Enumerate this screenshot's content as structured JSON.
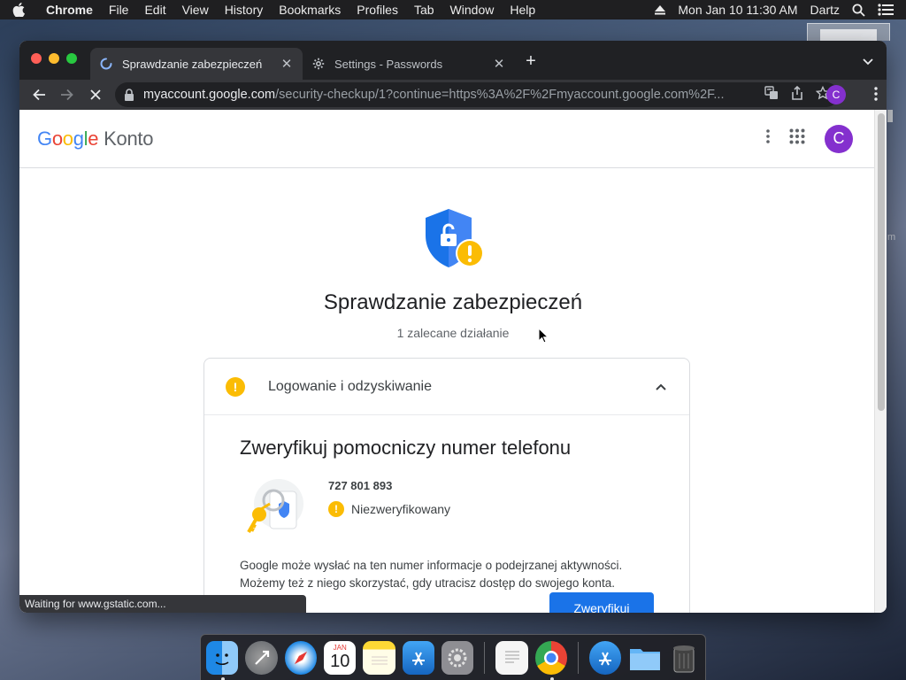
{
  "menubar": {
    "items": [
      "Chrome",
      "File",
      "Edit",
      "View",
      "History",
      "Bookmarks",
      "Profiles",
      "Tab",
      "Window",
      "Help"
    ],
    "clock": "Mon Jan 10  11:30 AM",
    "user": "Dartz"
  },
  "tabs": [
    {
      "title": "Sprawdzanie zabezpieczeń",
      "active": true
    },
    {
      "title": "Settings - Passwords",
      "active": false
    }
  ],
  "omnibox": {
    "host": "myaccount.google.com",
    "path": "/security-checkup/1?continue=https%3A%2F%2Fmyaccount.google.com%2F..."
  },
  "profile_initial": "C",
  "header": {
    "logo": {
      "G": "G",
      "o1": "o",
      "o2": "o",
      "g": "g",
      "l": "l",
      "e": "e"
    },
    "product": "Konto",
    "avatar_initial": "C"
  },
  "hero": {
    "title": "Sprawdzanie zabezpieczeń",
    "subtitle": "1 zalecane działanie"
  },
  "card": {
    "section_label": "Logowanie i odzyskiwanie",
    "heading": "Zweryfikuj pomocniczy numer telefonu",
    "phone_number": "727 801 893",
    "phone_status": "Niezweryfikowany",
    "description_line1": "Google może wysłać na ten numer informacje o podejrzanej aktywności.",
    "description_line2": "Możemy też z niego skorzystać, gdy utracisz dostęp do swojego konta.",
    "verify_button": "Zweryfikuj"
  },
  "status_bar": "Waiting for www.gstatic.com...",
  "dock": {
    "calendar_month": "JAN",
    "calendar_day": "10"
  },
  "side_fragment": "m",
  "colors": {
    "accent": "#1a73e8",
    "warning": "#fbbc04",
    "avatar": "#8430ce"
  }
}
